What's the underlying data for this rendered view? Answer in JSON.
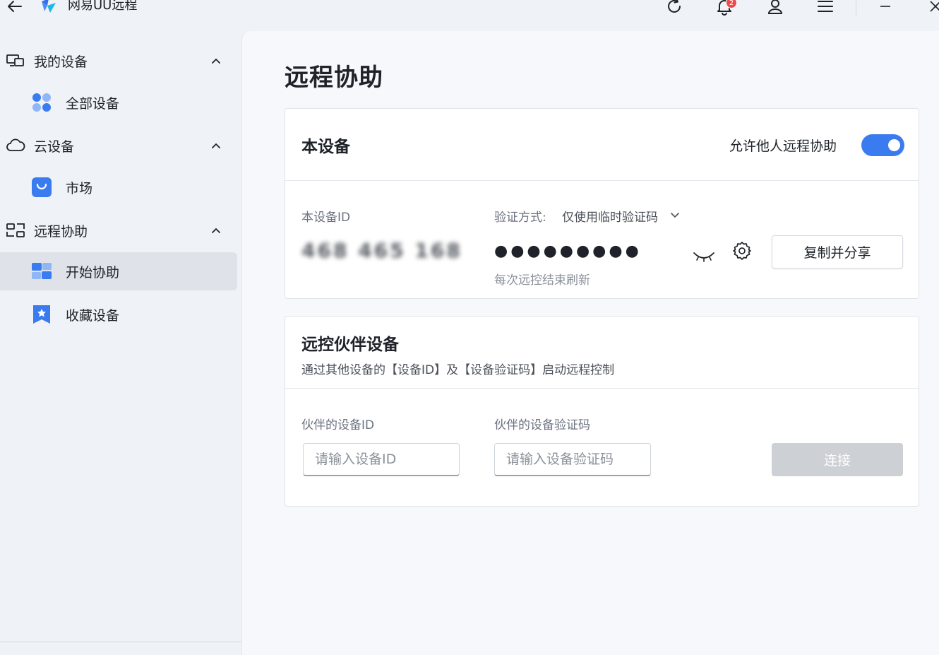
{
  "app": {
    "title": "网易UU远程",
    "notification_count": "2",
    "accent_color": "#3a7bf0"
  },
  "titlebar": {
    "icons": [
      "back-arrow-icon",
      "app-logo-icon",
      "refresh-icon",
      "bell-icon",
      "user-icon",
      "menu-icon",
      "minimize-icon",
      "close-icon"
    ]
  },
  "sidebar": {
    "groups": [
      {
        "label": "我的设备",
        "icon": "devices-icon",
        "expanded": true
      },
      {
        "label": "云设备",
        "icon": "cloud-icon",
        "expanded": true
      },
      {
        "label": "远程协助",
        "icon": "remote-assist-icon",
        "expanded": true
      }
    ],
    "items": [
      {
        "label": "全部设备",
        "icon": "all-devices-icon",
        "active": false
      },
      {
        "label": "市场",
        "icon": "market-bag-icon",
        "active": false
      },
      {
        "label": "开始协助",
        "icon": "start-assist-icon",
        "active": true
      },
      {
        "label": "收藏设备",
        "icon": "favorite-star-icon",
        "active": false
      }
    ]
  },
  "main": {
    "page_title": "远程协助",
    "this_device": {
      "title": "本设备",
      "allow_label": "允许他人远程协助",
      "allow_enabled": true,
      "device_id_label": "本设备ID",
      "device_id_value": "468 465 168",
      "auth_label": "验证方式:",
      "auth_value": "仅使用临时验证码",
      "password_masked": "●●●●●●●●●",
      "refresh_hint": "每次远控结束刷新",
      "copy_button": "复制并分享"
    },
    "partner": {
      "title": "远控伙伴设备",
      "subtitle": "通过其他设备的【设备ID】及【设备验证码】启动远程控制",
      "id_label": "伙伴的设备ID",
      "id_placeholder": "请输入设备ID",
      "code_label": "伙伴的设备验证码",
      "code_placeholder": "请输入设备验证码",
      "connect_button": "连接"
    }
  }
}
